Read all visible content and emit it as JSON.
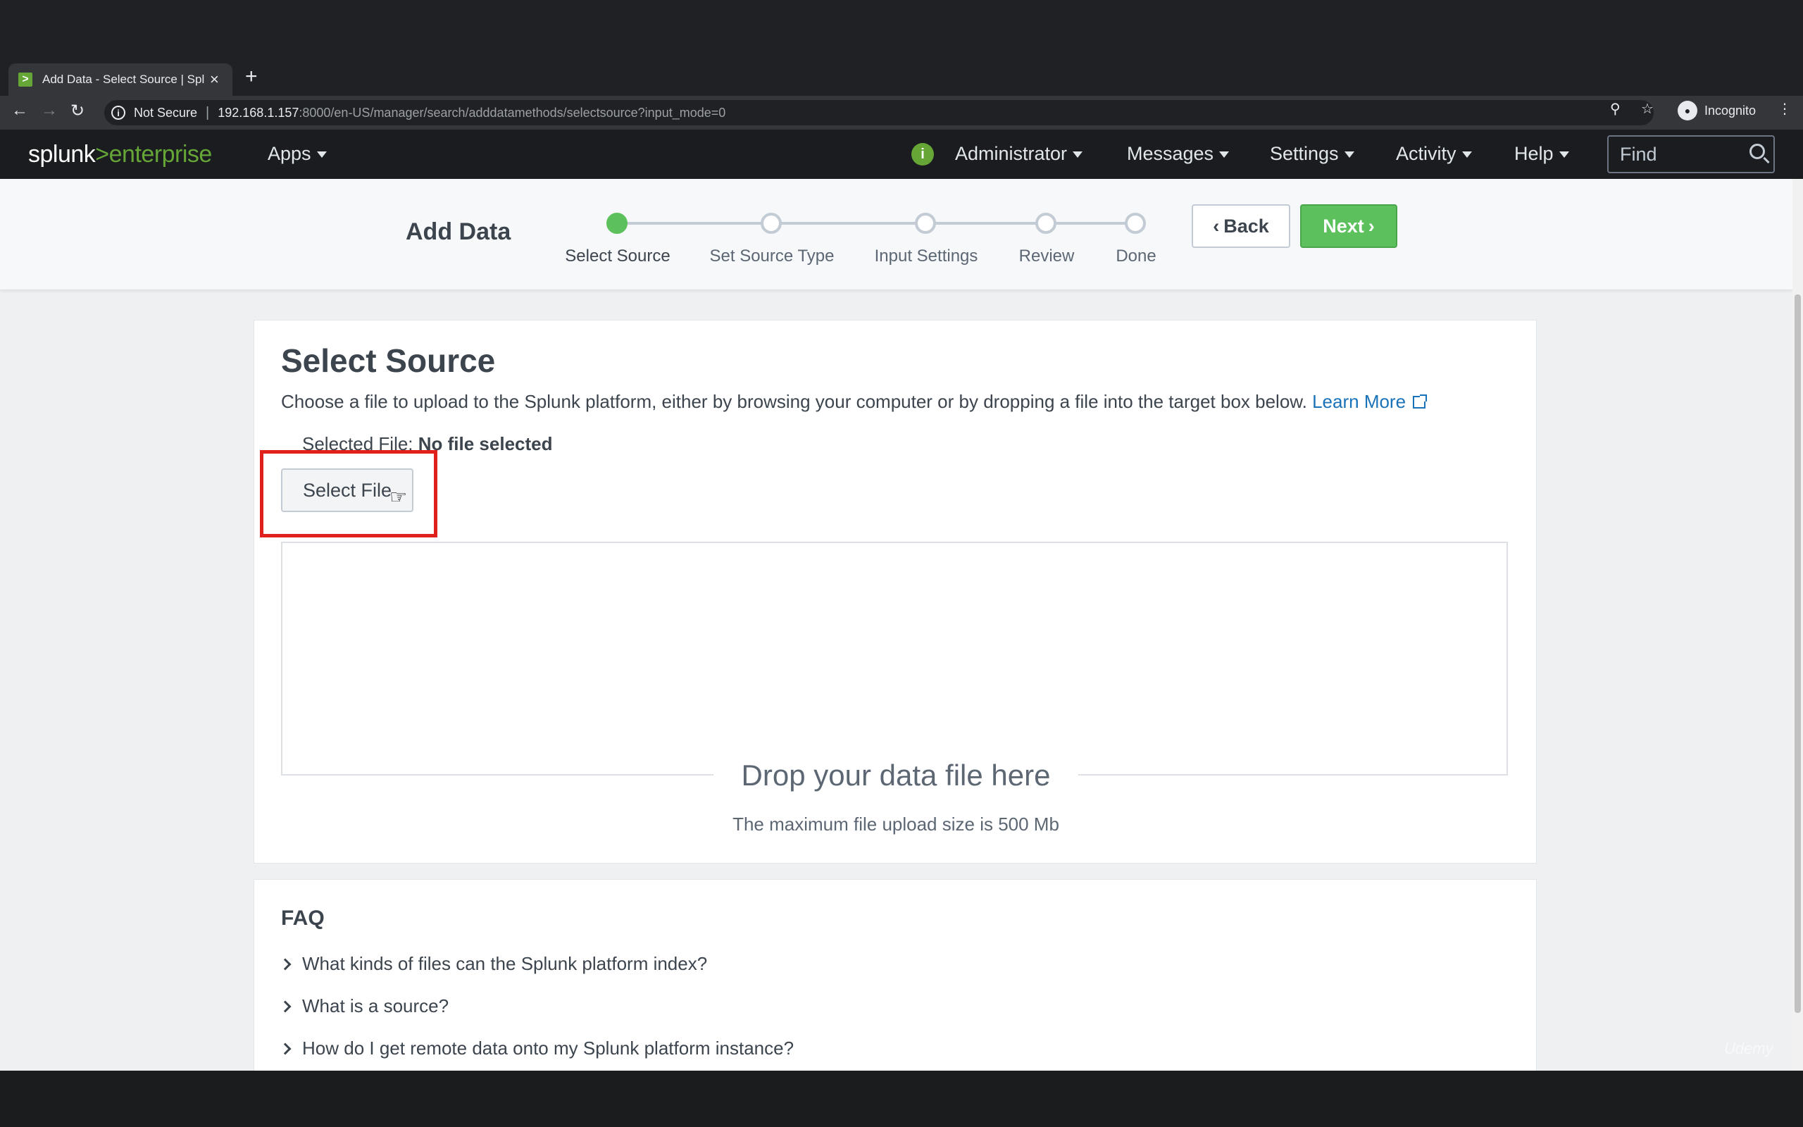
{
  "browser": {
    "tab_title": "Add Data - Select Source | Splunk",
    "new_tab": "+",
    "tab_close": "×",
    "not_secure": "Not Secure",
    "url_host": "192.168.1.157",
    "url_path": ":8000/en-US/manager/search/adddatamethods/selectsource?input_mode=0",
    "profile": "Incognito"
  },
  "appbar": {
    "logo_splunk": "splunk",
    "logo_gt": ">",
    "logo_enterprise": "enterprise",
    "apps": "Apps",
    "status_icon": "i",
    "admin": "Administrator",
    "messages": "Messages",
    "settings": "Settings",
    "activity": "Activity",
    "help": "Help",
    "find_placeholder": "Find"
  },
  "wizard": {
    "title": "Add Data",
    "steps": [
      {
        "label": "Select Source",
        "active": true
      },
      {
        "label": "Set Source Type",
        "active": false
      },
      {
        "label": "Input Settings",
        "active": false
      },
      {
        "label": "Review",
        "active": false
      },
      {
        "label": "Done",
        "active": false
      }
    ],
    "back": "Back",
    "next": "Next"
  },
  "panel": {
    "title": "Select Source",
    "description": "Choose a file to upload to the Splunk platform, either by browsing your computer or by dropping a file into the target box below.",
    "learn_more": "Learn More",
    "selected_file_label": "Selected File:",
    "selected_file_value": "No file selected",
    "select_button": "Select File",
    "drop_title": "Drop your data file here",
    "drop_subtitle": "The maximum file upload size is 500 Mb"
  },
  "faq": {
    "title": "FAQ",
    "items": [
      "What kinds of files can the Splunk platform index?",
      "What is a source?",
      "How do I get remote data onto my Splunk platform instance?"
    ]
  },
  "watermark": "Udemy",
  "colors": {
    "accent_green": "#5cc05c",
    "link_blue": "#1a73b8",
    "highlight_red": "#e0201b"
  }
}
